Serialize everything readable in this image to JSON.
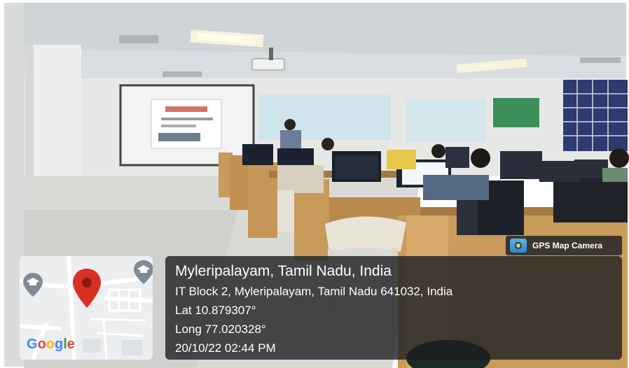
{
  "camera_badge": {
    "label": "GPS Map Camera",
    "icon": "camera-app-icon"
  },
  "map": {
    "brand": "Google",
    "pin_icon": "map-pin-icon",
    "pin_color": "#d93025",
    "poi_icons": [
      "graduation-cap-icon",
      "graduation-cap-icon"
    ]
  },
  "location": {
    "place": "Myleripalayam, Tamil Nadu, India",
    "address": "IT Block 2, Myleripalayam, Tamil Nadu 641032, India",
    "latitude": "Lat 10.879307°",
    "longitude": "Long 77.020328°",
    "datetime": "20/10/22 02:44 PM"
  }
}
